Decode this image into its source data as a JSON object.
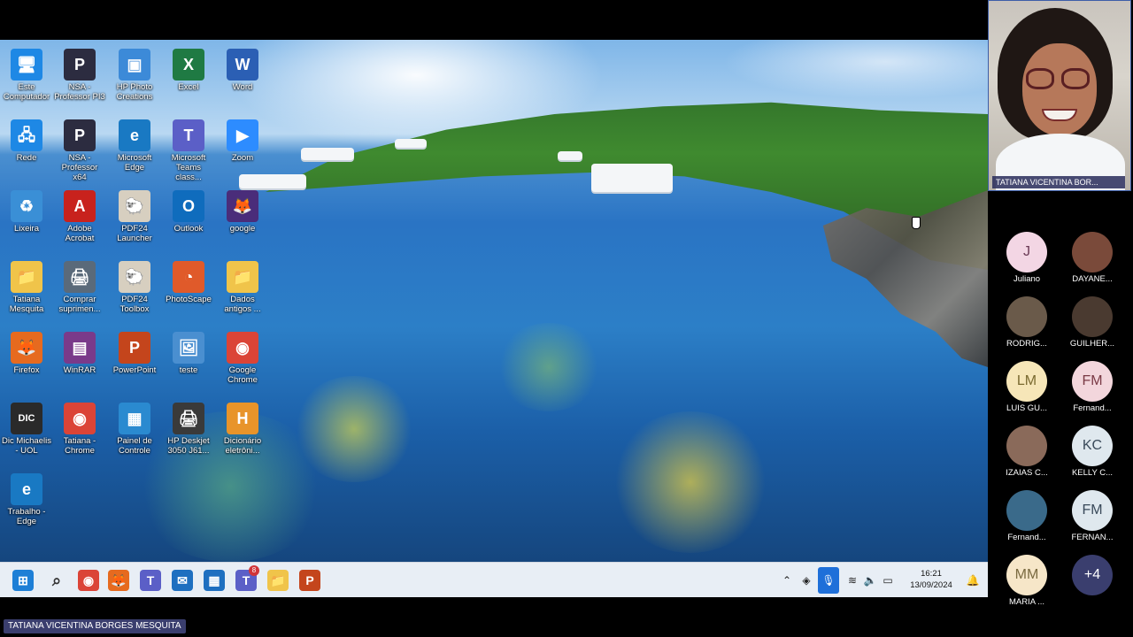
{
  "presenter": {
    "name": "TATIANA VICENTINA BORGES MESQUITA"
  },
  "speaker_tile": {
    "label": "TATIANA VICENTINA BOR..."
  },
  "desktop": {
    "icons": [
      {
        "id": "este-computador",
        "label": "Este Computador",
        "glyph": "🖥",
        "color": "#1e88e5"
      },
      {
        "id": "nsa-professor-pi3",
        "label": "NSA - Professor PI3",
        "glyph": "P",
        "color": "#2c2c40"
      },
      {
        "id": "hp-photo-creations",
        "label": "HP Photo Creations",
        "glyph": "▣",
        "color": "#3c8ad8"
      },
      {
        "id": "excel",
        "label": "Excel",
        "glyph": "X",
        "color": "#1f7a43"
      },
      {
        "id": "word",
        "label": "Word",
        "glyph": "W",
        "color": "#2b5fb4"
      },
      {
        "id": "rede",
        "label": "Rede",
        "glyph": "🖧",
        "color": "#1e88e5"
      },
      {
        "id": "nsa-professor-x64",
        "label": "NSA - Professor x64",
        "glyph": "P",
        "color": "#2c2c40"
      },
      {
        "id": "microsoft-edge",
        "label": "Microsoft Edge",
        "glyph": "e",
        "color": "#1979c3"
      },
      {
        "id": "microsoft-teams",
        "label": "Microsoft Teams class...",
        "glyph": "T",
        "color": "#5b5fc7"
      },
      {
        "id": "zoom",
        "label": "Zoom",
        "glyph": "▶",
        "color": "#2d8cff"
      },
      {
        "id": "lixeira",
        "label": "Lixeira",
        "glyph": "♻",
        "color": "#3a8fd6"
      },
      {
        "id": "adobe-acrobat",
        "label": "Adobe Acrobat",
        "glyph": "A",
        "color": "#c8221d"
      },
      {
        "id": "pdf24-launcher",
        "label": "PDF24 Launcher",
        "glyph": "🐑",
        "color": "#d7cfc0"
      },
      {
        "id": "outlook",
        "label": "Outlook",
        "glyph": "O",
        "color": "#0f6cbd"
      },
      {
        "id": "google",
        "label": "google",
        "glyph": "🦊",
        "color": "#4a2d7a"
      },
      {
        "id": "tatiana-mesquita",
        "label": "Tatiana Mesquita",
        "glyph": "📁",
        "color": "#f0c44a"
      },
      {
        "id": "comprar-suprimentos",
        "label": "Comprar suprimen...",
        "glyph": "🖨",
        "color": "#5a6a7a"
      },
      {
        "id": "pdf24-toolbox",
        "label": "PDF24 Toolbox",
        "glyph": "🐑",
        "color": "#d7cfc0"
      },
      {
        "id": "photoscape",
        "label": "PhotoScape",
        "glyph": "◔",
        "color": "#e05a2a"
      },
      {
        "id": "dados-antigos",
        "label": "Dados antigos ...",
        "glyph": "📁",
        "color": "#f0c44a"
      },
      {
        "id": "firefox",
        "label": "Firefox",
        "glyph": "🦊",
        "color": "#e66a1f"
      },
      {
        "id": "winrar",
        "label": "WinRAR",
        "glyph": "▤",
        "color": "#7a3a8a"
      },
      {
        "id": "powerpoint",
        "label": "PowerPoint",
        "glyph": "P",
        "color": "#c4451c"
      },
      {
        "id": "teste",
        "label": "teste",
        "glyph": "🖼",
        "color": "#4a8fd0"
      },
      {
        "id": "google-chrome",
        "label": "Google Chrome",
        "glyph": "◉",
        "color": "#db4437"
      },
      {
        "id": "dic-michaelis",
        "label": "Dic Michaelis - UOL",
        "glyph": "DIC",
        "color": "#2a2a2a"
      },
      {
        "id": "tatiana-chrome",
        "label": "Tatiana - Chrome",
        "glyph": "◉",
        "color": "#db4437"
      },
      {
        "id": "painel-controle",
        "label": "Painel de Controle",
        "glyph": "▦",
        "color": "#2a8ad0"
      },
      {
        "id": "hp-deskjet",
        "label": "HP Deskjet 3050 J61...",
        "glyph": "🖨",
        "color": "#3a3a3a"
      },
      {
        "id": "dicionario-eletronico",
        "label": "Dicionário eletrôni...",
        "glyph": "H",
        "color": "#e8942a"
      },
      {
        "id": "trabalho-edge",
        "label": "Trabalho - Edge",
        "glyph": "e",
        "color": "#1979c3"
      }
    ]
  },
  "taskbar": {
    "items": [
      {
        "id": "start",
        "glyph": "⊞",
        "color": "#1e7fd6"
      },
      {
        "id": "search",
        "glyph": "⌕",
        "color": "#333333"
      },
      {
        "id": "chrome",
        "glyph": "◉",
        "color": "#db4437"
      },
      {
        "id": "firefox",
        "glyph": "🦊",
        "color": "#e66a1f"
      },
      {
        "id": "teams-chat",
        "glyph": "T",
        "color": "#5b5fc7"
      },
      {
        "id": "mail",
        "glyph": "✉",
        "color": "#1e6fc0"
      },
      {
        "id": "store",
        "glyph": "▦",
        "color": "#1e6fc0"
      },
      {
        "id": "teams",
        "glyph": "T",
        "color": "#5b5fc7",
        "badge": "8"
      },
      {
        "id": "file-explorer",
        "glyph": "📁",
        "color": "#f0c44a"
      },
      {
        "id": "powerpoint",
        "glyph": "P",
        "color": "#c4451c"
      }
    ],
    "tray": {
      "time": "16:21",
      "date": "13/09/2024"
    }
  },
  "participants": [
    {
      "id": "juliano",
      "name": "Juliano",
      "initials": "J",
      "bg": "#f3d6e4",
      "fg": "#6a3a55"
    },
    {
      "id": "dayane",
      "name": "DAYANE...",
      "initials": "",
      "bg": "#7a4a3a",
      "fg": "#fff"
    },
    {
      "id": "rodrigo",
      "name": "RODRIG...",
      "initials": "",
      "bg": "#6a5a4a",
      "fg": "#fff"
    },
    {
      "id": "guilherme",
      "name": "GUILHER...",
      "initials": "",
      "bg": "#4a3a30",
      "fg": "#fff"
    },
    {
      "id": "luis",
      "name": "LUIS GU...",
      "initials": "LM",
      "bg": "#f6e6b8",
      "fg": "#7a6a30"
    },
    {
      "id": "fernanda-1",
      "name": "Fernand...",
      "initials": "FM",
      "bg": "#f3d6dc",
      "fg": "#7a3a45"
    },
    {
      "id": "izaias",
      "name": "IZAIAS C...",
      "initials": "",
      "bg": "#8a6a5a",
      "fg": "#fff"
    },
    {
      "id": "kelly",
      "name": "KELLY C...",
      "initials": "KC",
      "bg": "#dfe8ee",
      "fg": "#3a4a5a"
    },
    {
      "id": "fernanda-2",
      "name": "Fernand...",
      "initials": "",
      "bg": "#3a6a8a",
      "fg": "#fff"
    },
    {
      "id": "fernanda-3",
      "name": "FERNAN...",
      "initials": "FM",
      "bg": "#dfe8ee",
      "fg": "#3a4a5a"
    },
    {
      "id": "maria",
      "name": "MARIA ...",
      "initials": "MM",
      "bg": "#f6e6c8",
      "fg": "#7a6a40"
    },
    {
      "id": "more",
      "name": "",
      "initials": "+4",
      "bg": "#3a3e6e",
      "fg": "#fff"
    }
  ]
}
